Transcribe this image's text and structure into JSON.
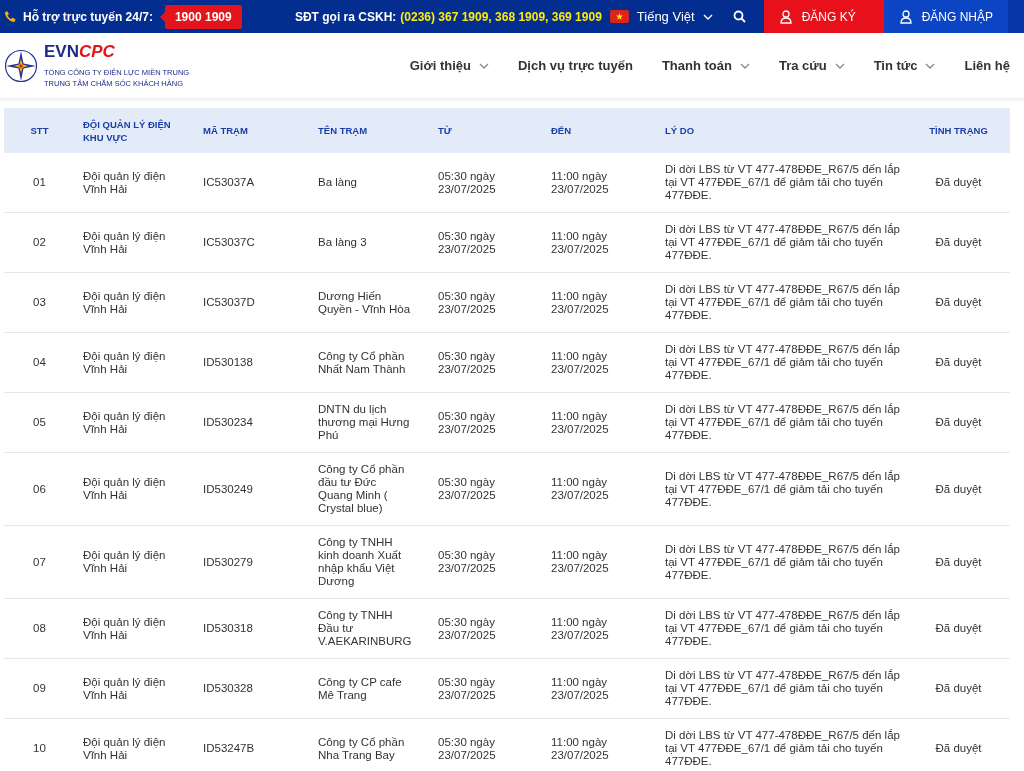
{
  "top_bar": {
    "support_label": "Hỗ trợ trực tuyến 24/7:",
    "hotline": "1900 1909",
    "cskh_label": "SĐT gọi ra CSKH:",
    "cskh_numbers": "(0236) 367 1909, 368 1909, 369 1909",
    "language": "Tiếng Việt",
    "register": "ĐĂNG KÝ",
    "login": "ĐĂNG NHẬP"
  },
  "header": {
    "brand": "EVN",
    "brand_accent": "CPC",
    "company": "TỔNG CÔNG TY ĐIỆN LỰC MIỀN TRUNG",
    "center": "TRUNG TÂM CHĂM SÓC KHÁCH HÀNG",
    "nav": [
      {
        "label": "Giới thiệu",
        "dropdown": true
      },
      {
        "label": "Dịch vụ trực tuyến",
        "dropdown": false
      },
      {
        "label": "Thanh toán",
        "dropdown": true
      },
      {
        "label": "Tra cứu",
        "dropdown": true
      },
      {
        "label": "Tin tức",
        "dropdown": true
      },
      {
        "label": "Liên hệ",
        "dropdown": false
      }
    ]
  },
  "table": {
    "columns": [
      "STT",
      "ĐỘI QUẢN LÝ ĐIỆN KHU VỰC",
      "MÃ TRẠM",
      "TÊN TRẠM",
      "TỪ",
      "ĐẾN",
      "LÝ DO",
      "TÌNH TRẠNG"
    ],
    "rows": [
      [
        "01",
        "Đội quản lý điện Vĩnh Hải",
        "IC53037A",
        "Ba làng",
        "05:30 ngày 23/07/2025",
        "11:00 ngày 23/07/2025",
        "Di dời LBS từ VT 477-478ĐĐE_R67/5 đến lắp tại VT 477ĐĐE_67/1 để giảm tải cho tuyến 477ĐĐE.",
        "Đã duyệt"
      ],
      [
        "02",
        "Đội quản lý điện Vĩnh Hải",
        "IC53037C",
        "Ba làng 3",
        "05:30 ngày 23/07/2025",
        "11:00 ngày 23/07/2025",
        "Di dời LBS từ VT 477-478ĐĐE_R67/5 đến lắp tại VT 477ĐĐE_67/1 để giảm tải cho tuyến 477ĐĐE.",
        "Đã duyệt"
      ],
      [
        "03",
        "Đội quản lý điện Vĩnh Hải",
        "IC53037D",
        "Dương Hiến Quyền - Vĩnh Hòa",
        "05:30 ngày 23/07/2025",
        "11:00 ngày 23/07/2025",
        "Di dời LBS từ VT 477-478ĐĐE_R67/5 đến lắp tại VT 477ĐĐE_67/1 để giảm tải cho tuyến 477ĐĐE.",
        "Đã duyệt"
      ],
      [
        "04",
        "Đội quản lý điện Vĩnh Hải",
        "ID530138",
        "Công ty Cổ phần Nhất Nam Thành",
        "05:30 ngày 23/07/2025",
        "11:00 ngày 23/07/2025",
        "Di dời LBS từ VT 477-478ĐĐE_R67/5 đến lắp tại VT 477ĐĐE_67/1 để giảm tải cho tuyến 477ĐĐE.",
        "Đã duyệt"
      ],
      [
        "05",
        "Đội quản lý điện Vĩnh Hải",
        "ID530234",
        "DNTN du lịch thương mại Hưng Phú",
        "05:30 ngày 23/07/2025",
        "11:00 ngày 23/07/2025",
        "Di dời LBS từ VT 477-478ĐĐE_R67/5 đến lắp tại VT 477ĐĐE_67/1 để giảm tải cho tuyến 477ĐĐE.",
        "Đã duyệt"
      ],
      [
        "06",
        "Đội quản lý điện Vĩnh Hải",
        "ID530249",
        "Công ty Cổ phần đầu tư Đức Quang Minh ( Crystal blue)",
        "05:30 ngày 23/07/2025",
        "11:00 ngày 23/07/2025",
        "Di dời LBS từ VT 477-478ĐĐE_R67/5 đến lắp tại VT 477ĐĐE_67/1 để giảm tải cho tuyến 477ĐĐE.",
        "Đã duyệt"
      ],
      [
        "07",
        "Đội quản lý điện Vĩnh Hải",
        "ID530279",
        "Công ty TNHH kinh doanh Xuất nhập khẩu Việt Dương",
        "05:30 ngày 23/07/2025",
        "11:00 ngày 23/07/2025",
        "Di dời LBS từ VT 477-478ĐĐE_R67/5 đến lắp tại VT 477ĐĐE_67/1 để giảm tải cho tuyến 477ĐĐE.",
        "Đã duyệt"
      ],
      [
        "08",
        "Đội quản lý điện Vĩnh Hải",
        "ID530318",
        "Công ty TNHH Đầu tư V.AEKARINBURG",
        "05:30 ngày 23/07/2025",
        "11:00 ngày 23/07/2025",
        "Di dời LBS từ VT 477-478ĐĐE_R67/5 đến lắp tại VT 477ĐĐE_67/1 để giảm tải cho tuyến 477ĐĐE.",
        "Đã duyệt"
      ],
      [
        "09",
        "Đội quản lý điện Vĩnh Hải",
        "ID530328",
        "Công ty CP cafe Mê Trang",
        "05:30 ngày 23/07/2025",
        "11:00 ngày 23/07/2025",
        "Di dời LBS từ VT 477-478ĐĐE_R67/5 đến lắp tại VT 477ĐĐE_67/1 để giảm tải cho tuyến 477ĐĐE.",
        "Đã duyệt"
      ],
      [
        "10",
        "Đội quản lý điện Vĩnh Hải",
        "ID53247B",
        "Công ty Cổ phần Nha Trang Bay",
        "05:30 ngày 23/07/2025",
        "11:00 ngày 23/07/2025",
        "Di dời LBS từ VT 477-478ĐĐE_R67/5 đến lắp tại VT 477ĐĐE_67/1 để giảm tải cho tuyến 477ĐĐE.",
        "Đã duyệt"
      ]
    ]
  }
}
